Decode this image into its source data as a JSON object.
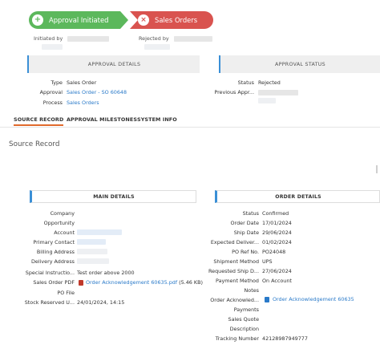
{
  "flow": {
    "step1": "Approval Initiated",
    "step2": "Sales Orders"
  },
  "meta": {
    "initiated_by_label": "Initiated by",
    "rejected_by_label": "Rejected by"
  },
  "approval_details": {
    "title": "APPROVAL DETAILS",
    "type_label": "Type",
    "type_value": "Sales Order",
    "approval_label": "Approval",
    "approval_value": "Sales Order - SO 60648",
    "process_label": "Process",
    "process_value": "Sales Orders"
  },
  "approval_status": {
    "title": "APPROVAL STATUS",
    "status_label": "Status",
    "status_value": "Rejected",
    "previous_label": "Previous Appr..."
  },
  "tabs": [
    "SOURCE RECORD",
    "APPROVAL MILESTONES",
    "SYSTEM INFO"
  ],
  "page_title": "Source Record",
  "main_details": {
    "title": "MAIN DETAILS",
    "company_label": "Company",
    "opportunity_label": "Opportunity",
    "account_label": "Account",
    "primary_contact_label": "Primary Contact",
    "billing_label": "Billing Address",
    "delivery_label": "Delivery Address",
    "special_label": "Special Instructio...",
    "special_value": "Test order above 2000",
    "sales_pdf_label": "Sales Order PDF",
    "sales_pdf_value": "Order Acknowledgement 60635.pdf",
    "sales_pdf_size": "(5.46 KB)",
    "po_file_label": "PO File",
    "stock_label": "Stock Reserved U...",
    "stock_value": "24/01/2024, 14:15"
  },
  "order_details": {
    "title": "ORDER DETAILS",
    "status_label": "Status",
    "status_value": "Confirmed",
    "order_date_label": "Order Date",
    "order_date_value": "17/01/2024",
    "ship_date_label": "Ship Date",
    "ship_date_value": "29/06/2024",
    "expected_label": "Expected Deliver...",
    "expected_value": "01/02/2024",
    "po_ref_label": "PO Ref No.",
    "po_ref_value": "PO24048",
    "shipment_label": "Shipment Method",
    "shipment_value": "UPS",
    "requested_label": "Requested Ship D...",
    "requested_value": "27/06/2024",
    "payment_method_label": "Payment Method",
    "payment_method_value": "On Account",
    "notes_label": "Notes",
    "order_ack_label": "Order Acknowled...",
    "order_ack_value": "Order Acknowledgement 60635",
    "payments_label": "Payments",
    "sales_quote_label": "Sales Quote",
    "description_label": "Description",
    "tracking_label": "Tracking Number",
    "tracking_value": "42128987949777"
  },
  "colors": {
    "approved": "#5cb85c",
    "rejected": "#d9534f",
    "accent": "#3a8fd6",
    "tab_active": "#e06a2c",
    "link": "#2a7ac9"
  }
}
